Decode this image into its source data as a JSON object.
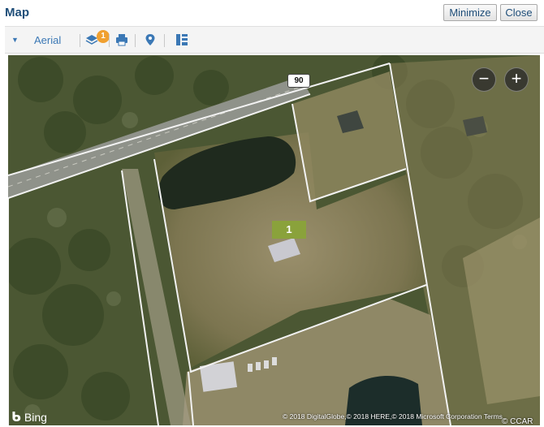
{
  "window": {
    "title": "Map",
    "minimize_label": "Minimize",
    "close_label": "Close"
  },
  "toolbar": {
    "map_style_label": "Aerial",
    "layers_badge": "1",
    "icons": [
      "chevron-down-icon",
      "layers-icon",
      "print-icon",
      "map-pin-icon",
      "list-view-icon"
    ]
  },
  "map": {
    "route_shield": "90",
    "property_marker": "1",
    "zoom_out_label": "−",
    "zoom_in_label": "+",
    "bing_label": "Bing",
    "copyright": "© 2018 DigitalGlobe,© 2018 HERE,© 2018 Microsoft Corporation  Terms",
    "watermark": "© CCAR"
  },
  "colors": {
    "title": "#1f4e79",
    "link": "#3b78b5",
    "marker": "#8aa23b",
    "badge": "#f0a030"
  }
}
